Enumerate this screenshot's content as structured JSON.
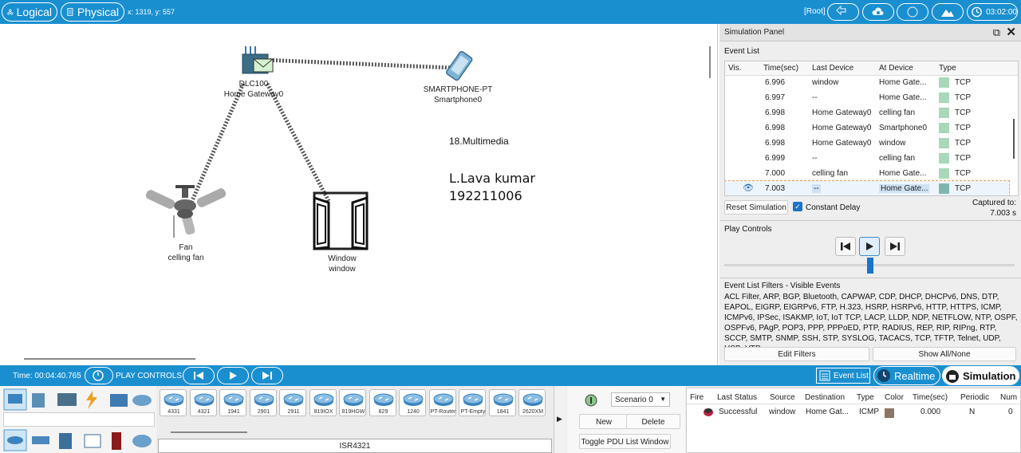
{
  "topbar": {
    "logical_label": "Logical",
    "physical_label": "Physical",
    "coords": "x: 1319, y: 557",
    "root_label": "[Root]",
    "clock": "03:02:00"
  },
  "workspace": {
    "devices": {
      "gateway": {
        "model": "DLC100",
        "name": "Home Gateway0"
      },
      "smartphone": {
        "model": "SMARTPHONE-PT",
        "name": "Smartphone0"
      },
      "fan": {
        "model": "Fan",
        "name": "celling fan"
      },
      "window": {
        "model": "Window",
        "name": "window"
      }
    },
    "note_title": "18.Multimedia",
    "note_author": "L.Lava kumar",
    "note_id": "192211006"
  },
  "sim_panel": {
    "title": "Simulation Panel",
    "event_list_label": "Event List",
    "columns": [
      "Vis.",
      "Time(sec)",
      "Last Device",
      "At Device",
      "Type"
    ],
    "rows": [
      {
        "time": "6.996",
        "last": "window",
        "at": "Home Gate...",
        "type": "TCP",
        "color": "#a8d8b9"
      },
      {
        "time": "6.997",
        "last": "--",
        "at": "Home Gate...",
        "type": "TCP",
        "color": "#a8d8b9"
      },
      {
        "time": "6.998",
        "last": "Home Gateway0",
        "at": "celling fan",
        "type": "TCP",
        "color": "#a8d8b9"
      },
      {
        "time": "6.998",
        "last": "Home Gateway0",
        "at": "Smartphone0",
        "type": "TCP",
        "color": "#a8d8b9"
      },
      {
        "time": "6.998",
        "last": "Home Gateway0",
        "at": "window",
        "type": "TCP",
        "color": "#a8d8b9"
      },
      {
        "time": "6.999",
        "last": "--",
        "at": "celling fan",
        "type": "TCP",
        "color": "#a8d8b9"
      },
      {
        "time": "7.000",
        "last": "celling fan",
        "at": "Home Gate...",
        "type": "TCP",
        "color": "#a8d8b9"
      },
      {
        "time": "7.003",
        "last": "--",
        "at": "Home Gate...",
        "type": "TCP",
        "color": "#7fb7b0"
      }
    ],
    "reset_label": "Reset Simulation",
    "constant_delay_label": "Constant Delay",
    "captured_label": "Captured to:",
    "captured_value": "7.003 s",
    "play_controls_label": "Play Controls",
    "filters_label": "Event List Filters - Visible Events",
    "filters_text": "ACL Filter, ARP, BGP, Bluetooth, CAPWAP, CDP, DHCP, DHCPv6, DNS, DTP, EAPOL, EIGRP, EIGRPv6, FTP, H.323, HSRP, HSRPv6, HTTP, HTTPS, ICMP, ICMPv6, IPSec, ISAKMP, IoT, IoT TCP, LACP, LLDP, NDP, NETFLOW, NTP, OSPF, OSPFv6, PAgP, POP3, PPP, PPPoED, PTP, RADIUS, REP, RIP, RIPng, RTP, SCCP, SMTP, SNMP, SSH, STP, SYSLOG, TACACS, TCP, TFTP, Telnet, UDP, USB, VTP",
    "edit_filters_label": "Edit Filters",
    "show_all_label": "Show All/None"
  },
  "bottombar": {
    "time_label": "Time: 00:04:40.765",
    "play_controls_label": "PLAY CONTROLS",
    "event_list_label": "Event List",
    "realtime_label": "Realtime",
    "simulation_label": "Simulation"
  },
  "device_bar": {
    "routers": [
      "4331",
      "4321",
      "1941",
      "2901",
      "2911",
      "819IOX",
      "819HGW",
      "829",
      "1240",
      "PT-Router",
      "PT-Empty",
      "1841",
      "2620XM"
    ],
    "selected_model": "ISR4321"
  },
  "scenario": {
    "selected": "Scenario 0",
    "new_label": "New",
    "delete_label": "Delete",
    "toggle_label": "Toggle PDU List Window"
  },
  "pdu_table": {
    "columns": [
      "Fire",
      "Last Status",
      "Source",
      "Destination",
      "Type",
      "Color",
      "Time(sec)",
      "Periodic",
      "Num"
    ],
    "rows": [
      {
        "status": "Successful",
        "source": "window",
        "destination": "Home Gat...",
        "type": "ICMP",
        "color": "#8b7565",
        "time": "0.000",
        "periodic": "N",
        "num": "0"
      }
    ]
  }
}
